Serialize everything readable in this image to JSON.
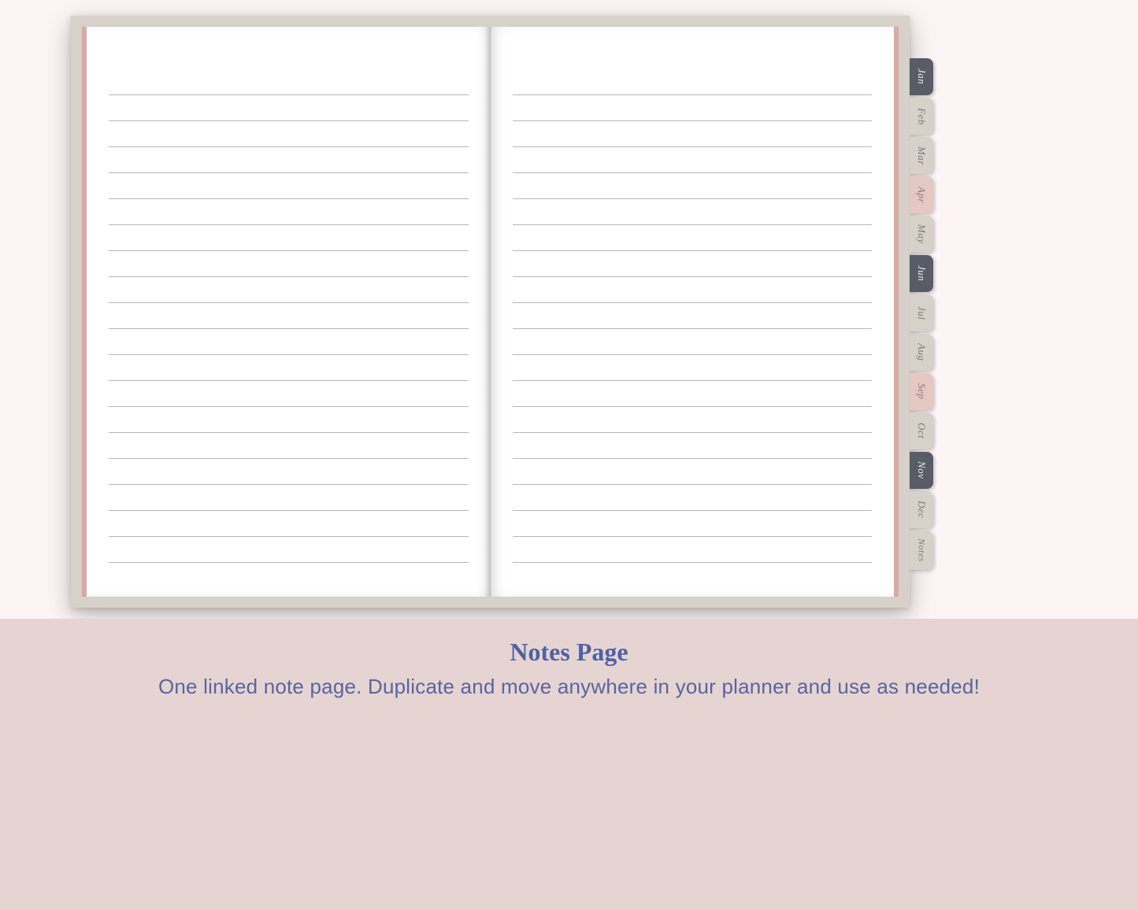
{
  "caption": {
    "title": "Notes Page",
    "subtitle": "One linked note page. Duplicate and move anywhere in your planner and use as needed!"
  },
  "rule_count": 19,
  "tabs": [
    {
      "label": "Jan",
      "style": "dark"
    },
    {
      "label": "Feb",
      "style": "lite"
    },
    {
      "label": "Mar",
      "style": "lite"
    },
    {
      "label": "Apr",
      "style": "pink"
    },
    {
      "label": "May",
      "style": "lite"
    },
    {
      "label": "Jun",
      "style": "dark"
    },
    {
      "label": "Jul",
      "style": "lite"
    },
    {
      "label": "Aug",
      "style": "lite"
    },
    {
      "label": "Sep",
      "style": "pink"
    },
    {
      "label": "Oct",
      "style": "lite"
    },
    {
      "label": "Nov",
      "style": "dark"
    },
    {
      "label": "Dec",
      "style": "lite"
    },
    {
      "label": "Notes",
      "style": "lite"
    }
  ],
  "colors": {
    "bg": "#fdf5f5",
    "planner_frame": "#d7d1c9",
    "binding": "#d9a9a4",
    "caption_bg": "#e6d4d2",
    "caption_text": "#4e62a3"
  }
}
